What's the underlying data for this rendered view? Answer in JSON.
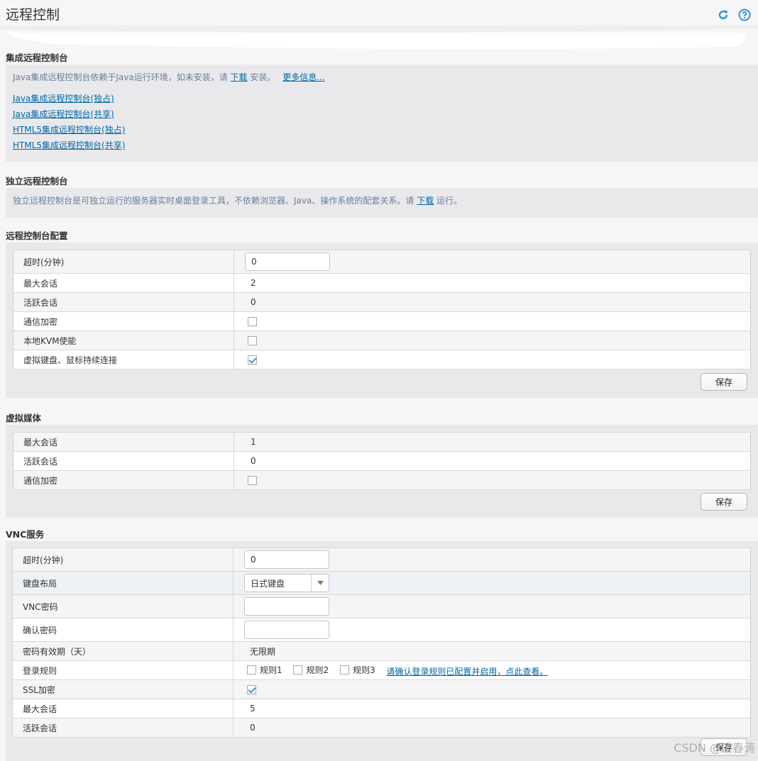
{
  "header": {
    "title": "远程控制",
    "refresh_icon": "refresh-icon",
    "help_icon": "help-icon"
  },
  "integrated_console": {
    "title": "集成远程控制台",
    "info_prefix": "Java集成远程控制台依赖于Java运行环境，如未安装，请",
    "download_link": "下载",
    "info_suffix": "安装。",
    "more_info_link": "更多信息...",
    "links": [
      "Java集成远程控制台(独占)",
      "Java集成远程控制台(共享)",
      "HTML5集成远程控制台(独占)",
      "HTML5集成远程控制台(共享)"
    ]
  },
  "standalone_console": {
    "title": "独立远程控制台",
    "info_prefix": "独立远程控制台是可独立运行的服务器实时桌面登录工具，不依赖浏览器、Java、操作系统的配套关系。请",
    "download_link": "下载",
    "info_suffix": "运行。"
  },
  "console_config": {
    "title": "远程控制台配置",
    "rows": {
      "timeout": {
        "label": "超时(分钟)",
        "value": "0"
      },
      "max_sessions": {
        "label": "最大会话",
        "value": "2"
      },
      "active_sessions": {
        "label": "活跃会话",
        "value": "0"
      },
      "encryption": {
        "label": "通信加密",
        "checked": false
      },
      "local_kvm": {
        "label": "本地KVM使能",
        "checked": false
      },
      "persistent_conn": {
        "label": "虚拟键盘、鼠标持续连接",
        "checked": true
      }
    },
    "save_label": "保存"
  },
  "virtual_media": {
    "title": "虚拟媒体",
    "rows": {
      "max_sessions": {
        "label": "最大会话",
        "value": "1"
      },
      "active_sessions": {
        "label": "活跃会话",
        "value": "0"
      },
      "encryption": {
        "label": "通信加密",
        "checked": false
      }
    },
    "save_label": "保存"
  },
  "vnc": {
    "title": "VNC服务",
    "rows": {
      "timeout": {
        "label": "超时(分钟)",
        "value": "0"
      },
      "keyboard_layout": {
        "label": "键盘布局",
        "value": "日式键盘"
      },
      "vnc_password": {
        "label": "VNC密码",
        "value": ""
      },
      "confirm_password": {
        "label": "确认密码",
        "value": ""
      },
      "password_validity": {
        "label": "密码有效期（天）",
        "value": "无限期"
      },
      "login_rules": {
        "label": "登录规则",
        "rules": [
          "规则1",
          "规则2",
          "规则3"
        ],
        "link": "请确认登录规则已配置并启用，点此查看。"
      },
      "ssl": {
        "label": "SSL加密",
        "checked": true
      },
      "max_sessions": {
        "label": "最大会话",
        "value": "5"
      },
      "active_sessions": {
        "label": "活跃会话",
        "value": "0"
      }
    },
    "save_label": "保存"
  },
  "watermark": "CSDN @王春涛"
}
